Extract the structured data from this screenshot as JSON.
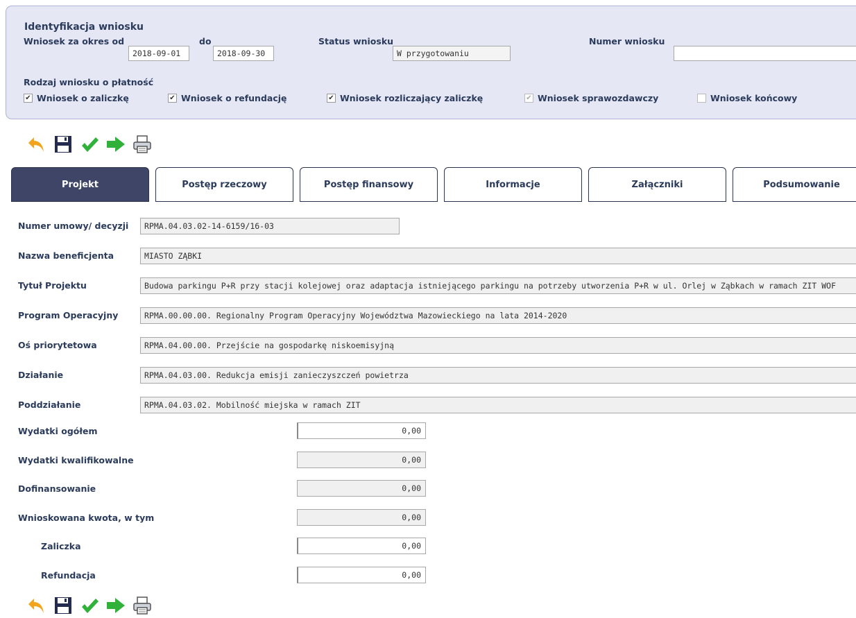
{
  "identification": {
    "title": "Identyfikacja wniosku",
    "period_from_label": "Wniosek za okres od",
    "period_from": "2018-09-01",
    "period_to_label": "do",
    "period_to": "2018-09-30",
    "status_label": "Status wniosku",
    "status_value": "W przygotowaniu",
    "number_label": "Numer wniosku",
    "number_value": "",
    "type_label": "Rodzaj wniosku o płatność",
    "types": [
      {
        "label": "Wniosek o zaliczkę",
        "checked": true
      },
      {
        "label": "Wniosek o refundację",
        "checked": true
      },
      {
        "label": "Wniosek rozliczający zaliczkę",
        "checked": true
      },
      {
        "label": "Wniosek sprawozdawczy",
        "checked": true
      },
      {
        "label": "Wniosek końcowy",
        "checked": false
      }
    ]
  },
  "icons": [
    "back-arrow-icon",
    "save-floppy-icon",
    "validate-check-icon",
    "submit-arrow-icon",
    "print-icon"
  ],
  "tabs": [
    {
      "label": "Projekt",
      "active": true
    },
    {
      "label": "Postęp rzeczowy"
    },
    {
      "label": "Postęp finansowy"
    },
    {
      "label": "Informacje"
    },
    {
      "label": "Załączniki"
    },
    {
      "label": "Podsumowanie"
    }
  ],
  "project": {
    "contract_label": "Numer umowy/ decyzji",
    "contract_value": "RPMA.04.03.02-14-6159/16-03",
    "beneficiary_label": "Nazwa beneficjenta",
    "beneficiary_value": "MIASTO ZĄBKI",
    "title_label": "Tytuł Projektu",
    "title_value": "Budowa parkingu P+R przy stacji kolejowej oraz adaptacja istniejącego parkingu na potrzeby utworzenia P+R w ul. Orlej w Ząbkach w ramach ZIT WOF",
    "program_label": "Program Operacyjny",
    "program_value": "RPMA.00.00.00. Regionalny Program Operacyjny Województwa Mazowieckiego na lata 2014-2020",
    "axis_label": "Oś priorytetowa",
    "axis_value": "RPMA.04.00.00. Przejście na gospodarkę niskoemisyjną",
    "action_label": "Działanie",
    "action_value": "RPMA.04.03.00. Redukcja emisji zanieczyszczeń powietrza",
    "subaction_label": "Poddziałanie",
    "subaction_value": "RPMA.04.03.02. Mobilność miejska w ramach ZIT"
  },
  "amounts": {
    "total_label": "Wydatki ogółem",
    "total_value": "0,00",
    "eligible_label": "Wydatki kwalifikowalne",
    "eligible_value": "0,00",
    "cofinancing_label": "Dofinansowanie",
    "cofinancing_value": "0,00",
    "requested_label": "Wnioskowana kwota, w tym",
    "requested_value": "0,00",
    "advance_label": "Zaliczka",
    "advance_value": "0,00",
    "refund_label": "Refundacja",
    "refund_value": "0,00"
  },
  "colors": {
    "panel_bg": "#e6e7f5",
    "tab_active_bg": "#3e4566",
    "label_text": "#2b3b5c",
    "icon_orange": "#f2a51c",
    "icon_green": "#2fb13a",
    "icon_navy": "#232b4f"
  }
}
